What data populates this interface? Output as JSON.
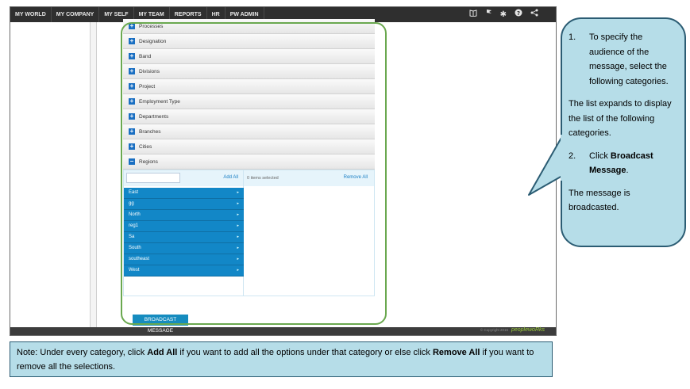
{
  "topnav": {
    "items": [
      "MY WORLD",
      "MY COMPANY",
      "MY SELF",
      "MY TEAM",
      "REPORTS",
      "HR",
      "PW ADMIN"
    ],
    "icons": [
      "book-icon",
      "flag-icon",
      "asterisk-icon",
      "help-icon",
      "share-icon"
    ]
  },
  "categories": [
    {
      "sign": "+",
      "label": "Processes"
    },
    {
      "sign": "+",
      "label": "Designation"
    },
    {
      "sign": "+",
      "label": "Band"
    },
    {
      "sign": "+",
      "label": "Divisions"
    },
    {
      "sign": "+",
      "label": "Project"
    },
    {
      "sign": "+",
      "label": "Employment Type"
    },
    {
      "sign": "+",
      "label": "Departments"
    },
    {
      "sign": "+",
      "label": "Branches"
    },
    {
      "sign": "+",
      "label": "Cities"
    },
    {
      "sign": "−",
      "label": "Regions"
    }
  ],
  "picker": {
    "add_all": "Add All",
    "selected_count": "0 items selected",
    "remove_all": "Remove All",
    "options": [
      "East",
      "gg",
      "North",
      "reg1",
      "Sa",
      "South",
      "southeast",
      "West"
    ]
  },
  "broadcast_button": "BROADCAST MESSAGE",
  "footer": {
    "copyright": "© Copyright 2016",
    "brand": "peoplewoRks"
  },
  "callout": {
    "step1_num": "1.",
    "step1_text": "To specify the audience of the message, select the following categories.",
    "para1": "The list expands to display the list of the following categories.",
    "step2_num": "2.",
    "step2_pre": "Click ",
    "step2_bold": "Broadcast Message",
    "step2_post": ".",
    "para2": "The message is broadcasted."
  },
  "note": {
    "p1": "Note: Under every category, click ",
    "b1": "Add All",
    "p2": " if you want to add all the options under that category or else click ",
    "b2": "Remove All",
    "p3": " if you want to remove all the selections."
  }
}
